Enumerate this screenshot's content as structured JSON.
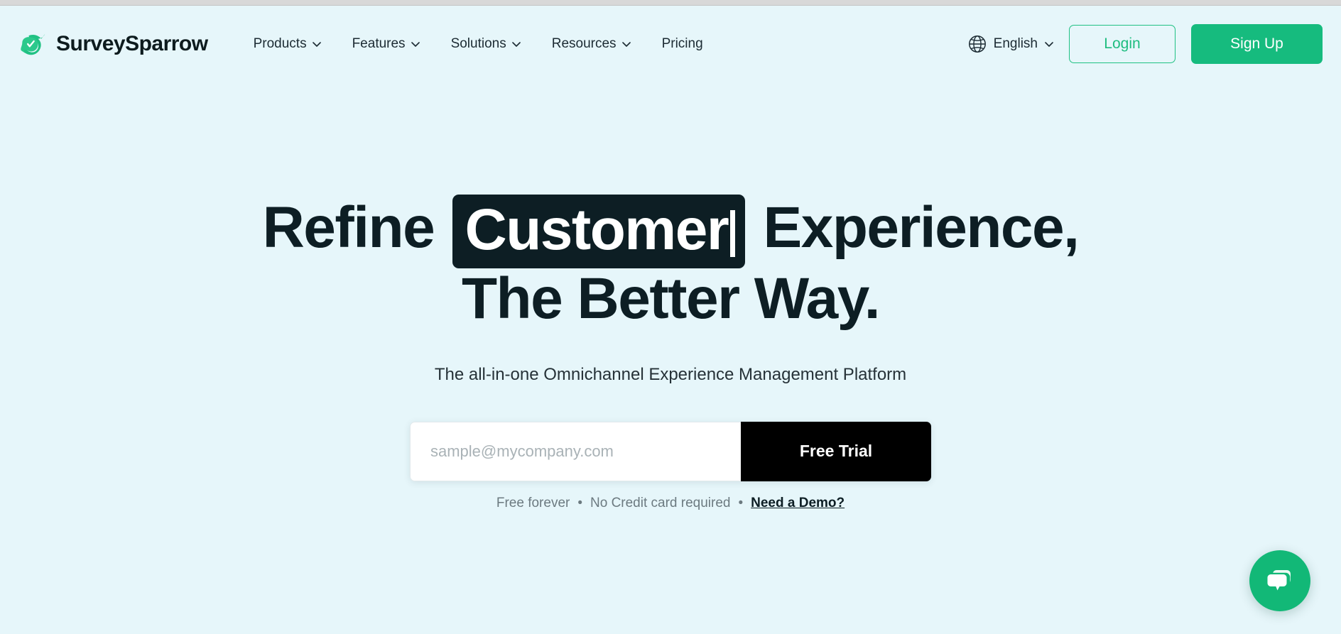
{
  "brand": {
    "name": "SurveySparrow",
    "logo_icon": "sparrow-check-logo",
    "logo_color": "#20c183"
  },
  "nav": {
    "items": [
      {
        "label": "Products",
        "has_dropdown": true,
        "icon": "chevron-down-icon"
      },
      {
        "label": "Features",
        "has_dropdown": true,
        "icon": "chevron-down-icon"
      },
      {
        "label": "Solutions",
        "has_dropdown": true,
        "icon": "chevron-down-icon"
      },
      {
        "label": "Resources",
        "has_dropdown": true,
        "icon": "chevron-down-icon"
      },
      {
        "label": "Pricing",
        "has_dropdown": false,
        "icon": ""
      }
    ]
  },
  "header_right": {
    "language": {
      "label": "English",
      "icon": "globe-icon",
      "chevron": "chevron-down-icon"
    },
    "login_label": "Login",
    "signup_label": "Sign Up"
  },
  "hero": {
    "headline_line1_prefix": "Refine",
    "headline_highlight": "Customer",
    "headline_line1_suffix": "Experience,",
    "headline_line2": "The Better Way.",
    "subtitle": "The all-in-one Omnichannel Experience Management Platform",
    "form": {
      "email_placeholder": "sample@mycompany.com",
      "email_value": "",
      "submit_label": "Free Trial"
    },
    "note": {
      "part1": "Free forever",
      "separator1": "•",
      "part2": "No Credit card required",
      "separator2": "•",
      "link": "Need a Demo?"
    }
  },
  "chat": {
    "icon": "chat-bubbles-icon",
    "color": "#12b877"
  },
  "colors": {
    "background": "#e6f6fa",
    "brand_green": "#20c183",
    "signup_green": "#16bb7e",
    "dark": "#0d1e24",
    "black": "#000000"
  }
}
